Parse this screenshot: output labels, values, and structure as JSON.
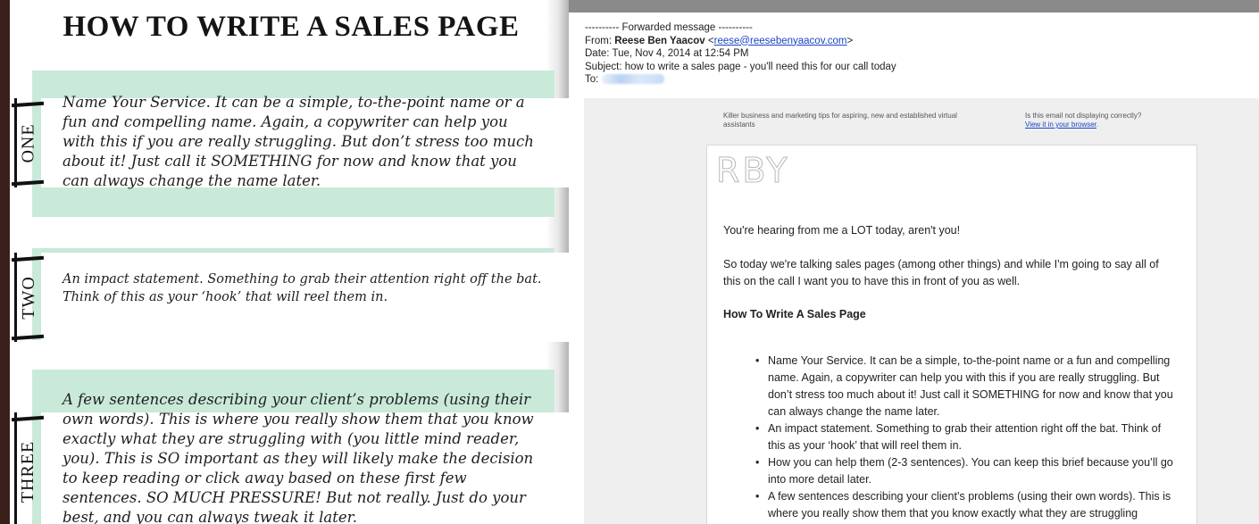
{
  "worksheet": {
    "title": "HOW TO WRITE A SALES PAGE",
    "steps": [
      {
        "label": "ONE",
        "text": "Name Your Service. It can be a simple, to-the-point name or a fun and compelling name. Again, a copywriter can help you with this if you are really struggling. But don’t stress too much about it! Just call it SOMETHING for now and know that you can always change the name later."
      },
      {
        "label": "TWO",
        "text": "An impact statement. Something to grab their attention right off the bat. Think of this as your ‘hook’ that will reel them in."
      },
      {
        "label": "THREE",
        "text": "A few sentences describing your client’s problems (using their own words). This is where you really show them that you know exactly what they are struggling with (you little mind reader, you). This is SO important as they will likely make the decision to keep reading or click away based on these first few sentences. SO MUCH PRESSURE! But not really. Just do your best, and you can always tweak it later."
      }
    ]
  },
  "email": {
    "forwarded_line": "---------- Forwarded message ----------",
    "from_label": "From:",
    "from_name": "Reese Ben Yaacov",
    "from_email": "reese@reesebenyaacov.com",
    "date_label": "Date:",
    "date_value": "Tue, Nov 4, 2014 at 12:54 PM",
    "subject_label": "Subject:",
    "subject_value": "how to write a sales page - you'll need this for our call today",
    "to_label": "To:",
    "preheader_left": "Killer business and marketing tips for aspiring, new and established virtual assistants",
    "preheader_right": "Is this email not displaying correctly?",
    "view_in_browser": "View it in your browser",
    "logo_text": "RBY",
    "greeting": "You're hearing from me a LOT today, aren't you!",
    "intro": "So today we're talking sales pages (among other things) and while I'm going to say all of this on the call I want you to have this in front of you as well.",
    "heading": "How To Write A Sales Page",
    "bullets": [
      "Name Your Service. It can be a simple, to-the-point name or a fun and compelling name. Again, a copywriter can help you with this if you are really struggling. But don’t stress too much about it! Just call it SOMETHING for now and know that you can always change the name later.",
      "An impact statement. Something to grab their attention right off the bat. Think of this as your ‘hook’ that will reel them in.",
      "How you can help them (2-3 sentences). You can keep this brief because you’ll go into more detail later.",
      "A few sentences describing your client’s problems (using their own words). This is where you really show them that you know exactly what they are struggling"
    ]
  }
}
